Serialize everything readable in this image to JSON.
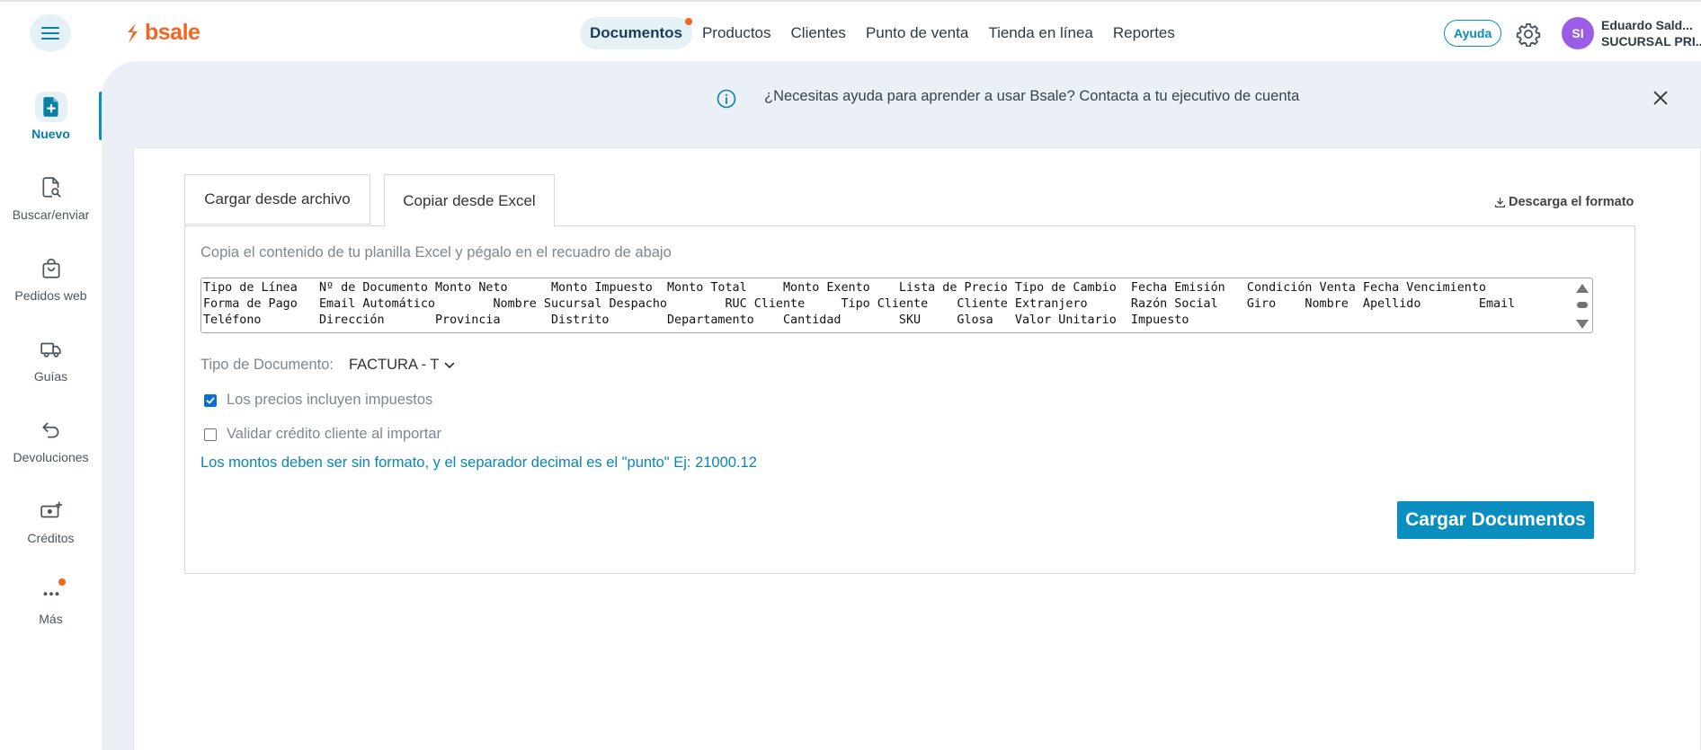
{
  "header": {
    "brand": "bsale",
    "nav": [
      {
        "label": "Documentos",
        "active": true,
        "notification": true
      },
      {
        "label": "Productos"
      },
      {
        "label": "Clientes"
      },
      {
        "label": "Punto de venta"
      },
      {
        "label": "Tienda en línea"
      },
      {
        "label": "Reportes"
      }
    ],
    "help_label": "Ayuda",
    "avatar_initials": "SI",
    "user_name": "Eduardo Sald...",
    "user_branch": "SUCURSAL PRI..."
  },
  "sidebar": {
    "items": [
      {
        "label": "Nuevo",
        "icon": "file-plus-icon",
        "active": true
      },
      {
        "label": "Buscar/enviar",
        "icon": "file-search-icon"
      },
      {
        "label": "Pedidos web",
        "icon": "shopping-bag-icon"
      },
      {
        "label": "Guías",
        "icon": "truck-icon"
      },
      {
        "label": "Devoluciones",
        "icon": "return-arrow-icon"
      },
      {
        "label": "Créditos",
        "icon": "cash-plus-icon"
      },
      {
        "label": "Más",
        "icon": "more-dots-icon",
        "notification": true
      }
    ]
  },
  "banner": {
    "text": "¿Necesitas ayuda para aprender a usar Bsale? Contacta a tu ejecutivo de cuenta"
  },
  "import": {
    "tabs": [
      {
        "label": "Cargar desde archivo"
      },
      {
        "label": "Copiar desde Excel",
        "active": true
      }
    ],
    "download_label": "Descarga el formato",
    "hint": "Copia el contenido de tu planilla Excel y pégalo en el recuadro de abajo",
    "textarea_lines": [
      "Tipo de Línea   Nº de Documento Monto Neto      Monto Impuesto  Monto Total     Monto Exento    Lista de Precio Tipo de Cambio  Fecha Emisión   Condición Venta Fecha Vencimiento",
      "Forma de Pago   Email Automático        Nombre Sucursal Despacho        RUC Cliente     Tipo Cliente    Cliente Extranjero      Razón Social    Giro    Nombre  Apellido        Email",
      "Teléfono        Dirección       Provincia       Distrito        Departamento    Cantidad        SKU     Glosa   Valor Unitario  Impuesto"
    ],
    "doc_type_label": "Tipo de Documento:",
    "doc_type_value": "FACTURA - T",
    "checkbox_prices": {
      "label": "Los precios incluyen impuestos",
      "checked": true
    },
    "checkbox_credit": {
      "label": "Validar crédito cliente al importar",
      "checked": false
    },
    "note": "Los montos deben ser sin formato, y el separador decimal es el \"punto\" Ej: 21000.12",
    "submit_label": "Cargar Documentos"
  },
  "colors": {
    "brand": "#f26522",
    "accent": "#0a8ec0",
    "background": "#eaf0f5"
  }
}
